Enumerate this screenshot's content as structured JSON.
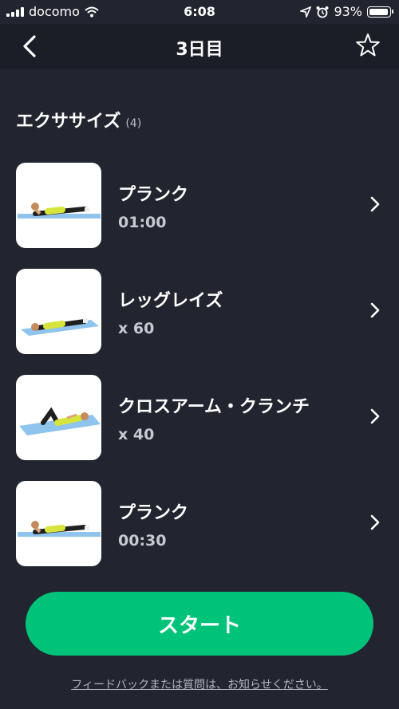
{
  "status_bar": {
    "carrier": "docomo",
    "time": "6:08",
    "battery_percent": "93%",
    "battery_level": 0.93,
    "icons": [
      "signal-icon",
      "wifi-icon",
      "location-icon",
      "alarm-icon",
      "battery-icon"
    ]
  },
  "nav": {
    "title": "3日目",
    "back_icon": "chevron-left-icon",
    "favorite_icon": "star-outline-icon"
  },
  "section": {
    "title": "エクササイズ",
    "count": "(4)"
  },
  "exercises": [
    {
      "name": "プランク",
      "meta": "01:00",
      "thumbnail": "plank-illustration"
    },
    {
      "name": "レッグレイズ",
      "meta": "x 60",
      "thumbnail": "leg-raise-illustration"
    },
    {
      "name": "クロスアーム・クランチ",
      "meta": "x 40",
      "thumbnail": "cross-arm-crunch-illustration"
    },
    {
      "name": "プランク",
      "meta": "00:30",
      "thumbnail": "plank-illustration"
    }
  ],
  "start_button": {
    "label": "スタート"
  },
  "feedback_link": {
    "label": "フィードバックまたは質問は、お知らせください。"
  },
  "colors": {
    "background": "#22252f",
    "nav_background": "#1b1e27",
    "accent": "#00c37a",
    "mat": "#8fc4ee",
    "shirt": "#d7e43b"
  }
}
